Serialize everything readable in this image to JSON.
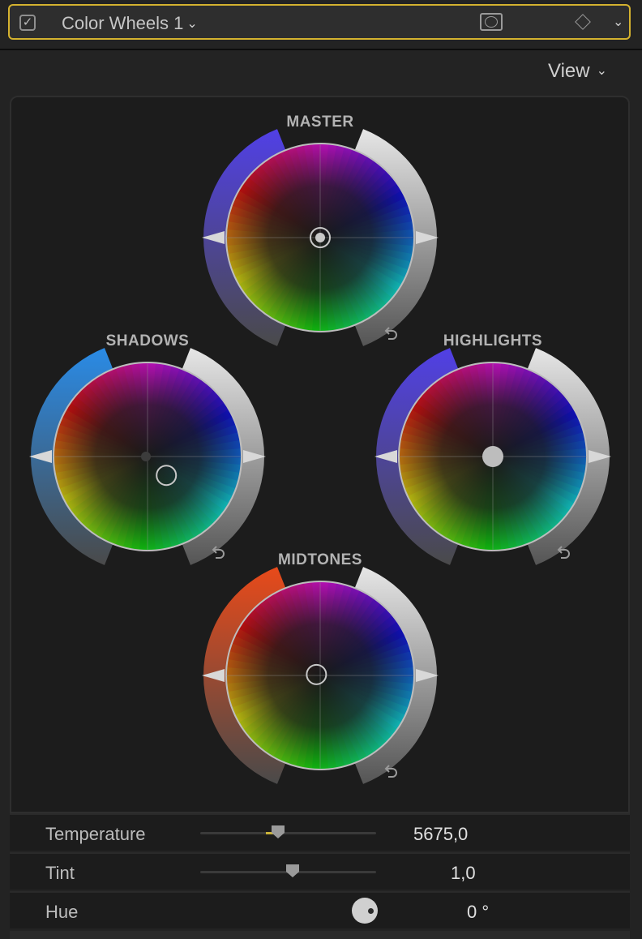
{
  "header": {
    "enabled": true,
    "title": "Color Wheels 1",
    "mask_icon": "oval-mask-icon",
    "keyframe_icon": "keyframe-diamond-icon",
    "accent_color": "#d4b22f"
  },
  "view_menu": {
    "label": "View"
  },
  "wheels": [
    {
      "id": "master",
      "label": "MASTER",
      "left_arc_color": "#5140e6",
      "puck": [
        0.0,
        0.0
      ]
    },
    {
      "id": "shadows",
      "label": "SHADOWS",
      "left_arc_color": "#2a8be6",
      "puck": [
        0.2,
        0.2
      ]
    },
    {
      "id": "highlights",
      "label": "HIGHLIGHTS",
      "left_arc_color": "#5140e6",
      "puck": [
        0.0,
        0.0
      ]
    },
    {
      "id": "midtones",
      "label": "MIDTONES",
      "left_arc_color": "#e84a1a",
      "puck": [
        -0.04,
        -0.01
      ]
    }
  ],
  "params": {
    "temperature": {
      "label": "Temperature",
      "value": "5675,0",
      "slider": 0.43
    },
    "tint": {
      "label": "Tint",
      "value": "1,0",
      "slider": 0.51
    },
    "hue": {
      "label": "Hue",
      "value": "0 °"
    }
  }
}
